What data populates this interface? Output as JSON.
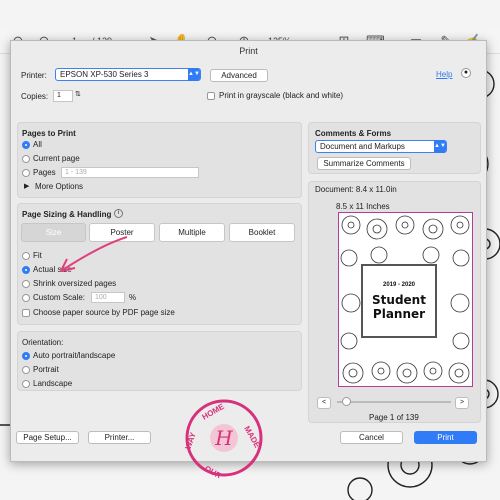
{
  "toolbar": {
    "page_current": "1",
    "page_total": "/ 139",
    "zoom": "125%"
  },
  "dialog": {
    "title": "Print",
    "printer_label": "Printer:",
    "printer_value": "EPSON XP-530 Series 3",
    "advanced": "Advanced",
    "help": "Help",
    "copies_label": "Copies:",
    "copies_value": "1",
    "grayscale": "Print in grayscale (black and white)",
    "pages": {
      "title": "Pages to Print",
      "all": "All",
      "current": "Current page",
      "pages": "Pages",
      "pages_placeholder": "1 - 139",
      "more": "More Options"
    },
    "sizing": {
      "title": "Page Sizing & Handling",
      "tabs": [
        "Size",
        "Poster",
        "Multiple",
        "Booklet"
      ],
      "fit": "Fit",
      "actual": "Actual size",
      "shrink": "Shrink oversized pages",
      "custom": "Custom Scale:",
      "custom_value": "100",
      "percent": "%",
      "choose_source": "Choose paper source by PDF page size"
    },
    "orientation": {
      "title": "Orientation:",
      "auto": "Auto portrait/landscape",
      "portrait": "Portrait",
      "landscape": "Landscape"
    },
    "comments": {
      "title": "Comments & Forms",
      "value": "Document and Markups",
      "summarize": "Summarize Comments"
    },
    "preview": {
      "document": "Document: 8.4 x 11.0in",
      "size": "8.5 x 11 Inches",
      "card_year": "2019 - 2020",
      "card_title1": "Student",
      "card_title2": "Planner",
      "prev": "<",
      "next": ">",
      "page_of": "Page 1 of 139"
    },
    "page_setup": "Page Setup...",
    "printer_btn": "Printer...",
    "cancel": "Cancel",
    "print": "Print"
  },
  "stamp": {
    "text": "HOME MADE OUR WAY",
    "letter": "H"
  },
  "colors": {
    "accent": "#2f7cf6",
    "stamp": "#d8307a",
    "arrow": "#e0407f"
  }
}
